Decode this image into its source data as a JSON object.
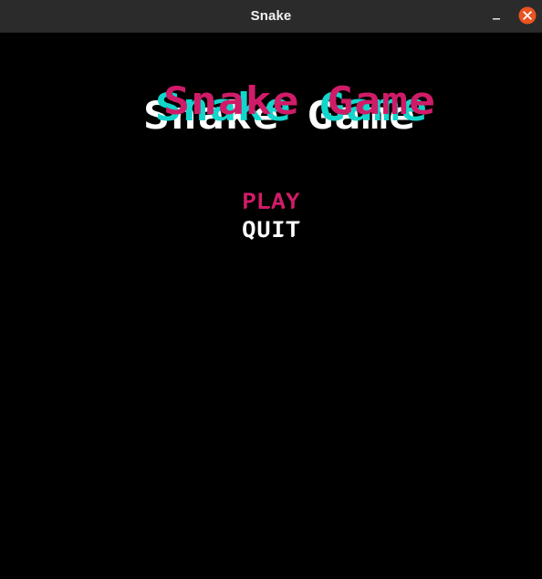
{
  "window": {
    "title": "Snake",
    "controls": {
      "minimize": "minimize-icon",
      "close": "close-icon"
    }
  },
  "game": {
    "logo": {
      "layers": [
        {
          "text": "Snake Game",
          "color": "#ffffff"
        },
        {
          "text": "Snake Game",
          "color": "#12d6cc"
        },
        {
          "text": "Snake Game",
          "color": "#d01c68"
        }
      ]
    },
    "menu": {
      "items": [
        {
          "label": "PLAY",
          "color": "#d01c68",
          "selected": true
        },
        {
          "label": "QUIT",
          "color": "#ffffff",
          "selected": false
        }
      ]
    }
  },
  "colors": {
    "background": "#000000",
    "titlebar": "#2b2b2b",
    "titleText": "#f2f2f2",
    "close": "#e95420"
  }
}
